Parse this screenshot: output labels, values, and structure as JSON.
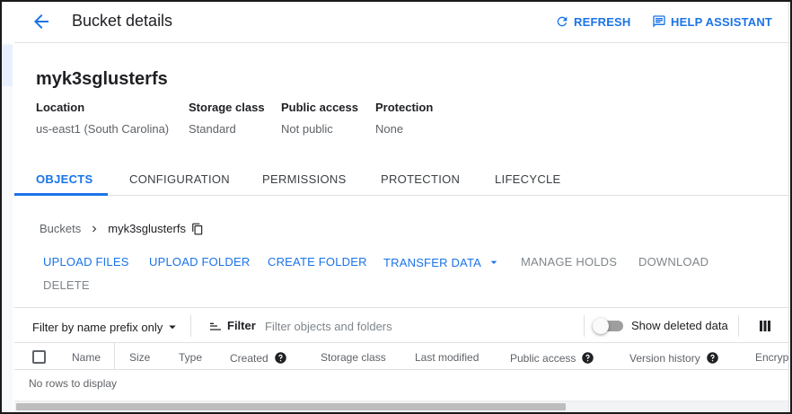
{
  "header": {
    "title": "Bucket details",
    "refresh_label": "REFRESH",
    "help_label": "HELP ASSISTANT"
  },
  "bucket": {
    "name": "myk3sglusterfs",
    "meta": [
      {
        "label": "Location",
        "value": "us-east1 (South Carolina)"
      },
      {
        "label": "Storage class",
        "value": "Standard"
      },
      {
        "label": "Public access",
        "value": "Not public"
      },
      {
        "label": "Protection",
        "value": "None"
      }
    ]
  },
  "tabs": [
    {
      "label": "OBJECTS",
      "active": true
    },
    {
      "label": "CONFIGURATION",
      "active": false
    },
    {
      "label": "PERMISSIONS",
      "active": false
    },
    {
      "label": "PROTECTION",
      "active": false
    },
    {
      "label": "LIFECYCLE",
      "active": false
    }
  ],
  "breadcrumb": {
    "root": "Buckets",
    "current": "myk3sglusterfs"
  },
  "actions": [
    {
      "label": "UPLOAD FILES",
      "enabled": true
    },
    {
      "label": "UPLOAD FOLDER",
      "enabled": true
    },
    {
      "label": "CREATE FOLDER",
      "enabled": true
    },
    {
      "label": "TRANSFER DATA",
      "enabled": true
    },
    {
      "label": "MANAGE HOLDS",
      "enabled": false
    },
    {
      "label": "DOWNLOAD",
      "enabled": false
    },
    {
      "label": "DELETE",
      "enabled": false
    }
  ],
  "filterbar": {
    "prefix_select": "Filter by name prefix only",
    "filter_label": "Filter",
    "filter_placeholder": "Filter objects and folders",
    "show_deleted_label": "Show deleted data",
    "show_deleted_on": false
  },
  "table": {
    "columns": [
      "Name",
      "Size",
      "Type",
      "Created",
      "Storage class",
      "Last modified",
      "Public access",
      "Version history",
      "Encrypt"
    ],
    "empty_message": "No rows to display"
  },
  "colors": {
    "accent": "#1a73e8",
    "disabled_text": "#80868b"
  },
  "icons": {
    "back": "arrow-back-icon",
    "refresh": "refresh-icon",
    "help": "feedback-icon",
    "copy": "copy-icon",
    "filter": "filter-icon",
    "columns": "columns-icon"
  }
}
